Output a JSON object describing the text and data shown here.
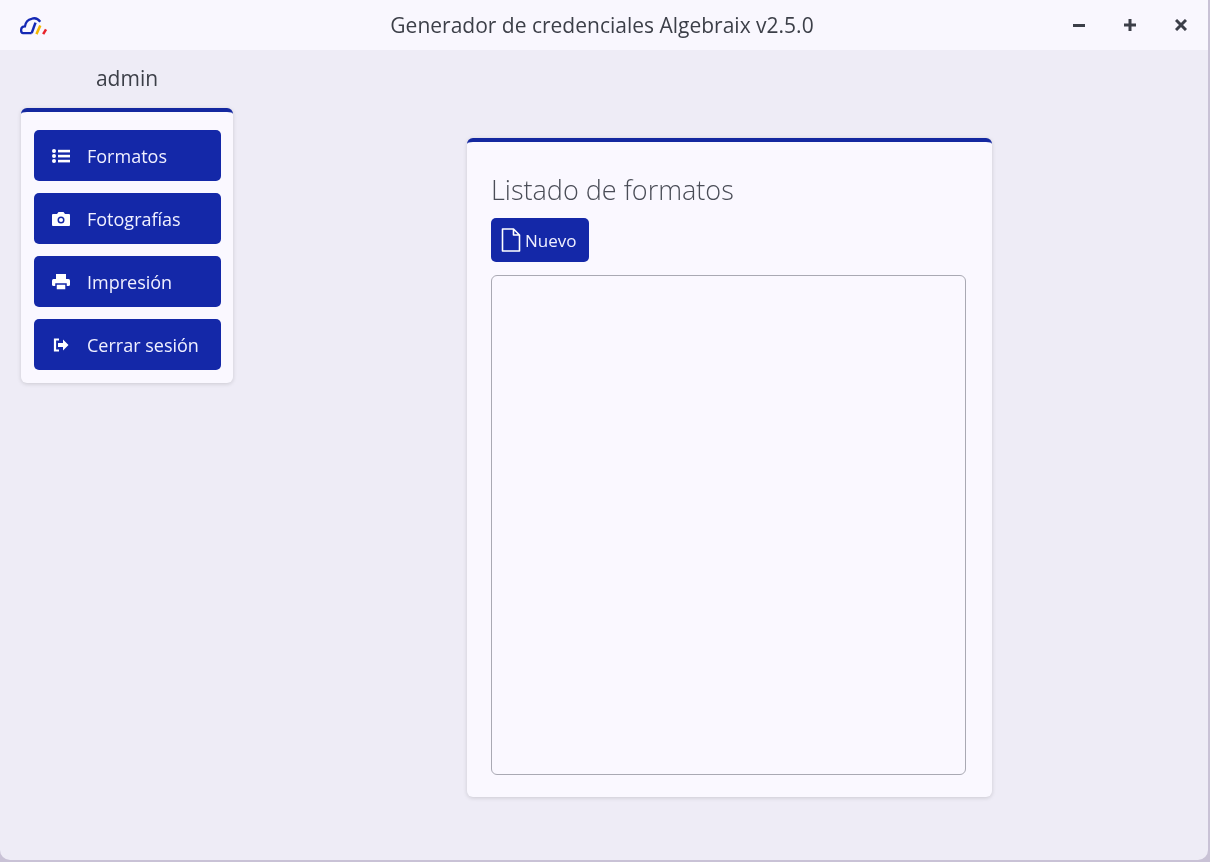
{
  "window": {
    "title": "Generador de credenciales Algebraix v2.5.0"
  },
  "user": {
    "name": "admin"
  },
  "sidebar": {
    "items": [
      {
        "label": "Formatos",
        "kind": "list"
      },
      {
        "label": "Fotografías",
        "kind": "camera"
      },
      {
        "label": "Impresión",
        "kind": "printer"
      },
      {
        "label": "Cerrar sesión",
        "kind": "logout"
      }
    ]
  },
  "panel": {
    "title": "Listado de formatos",
    "new_button": "Nuevo"
  }
}
